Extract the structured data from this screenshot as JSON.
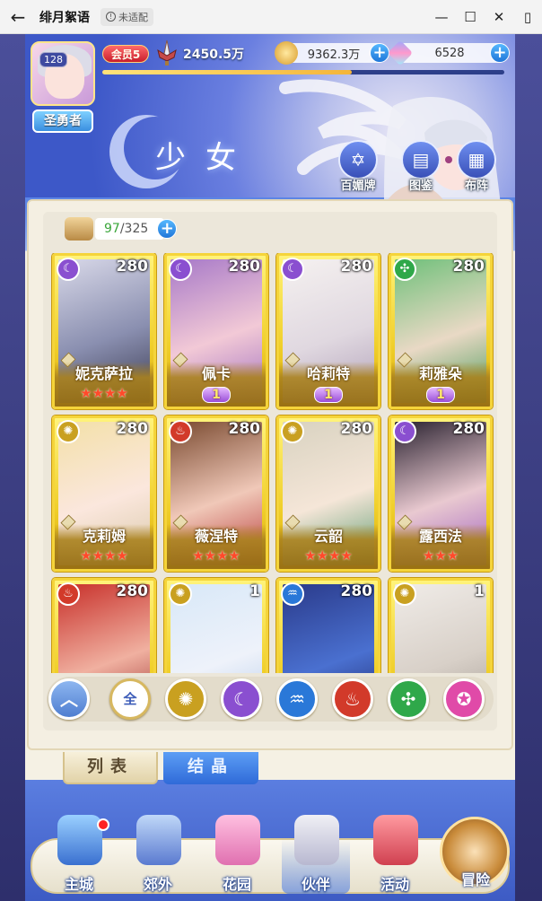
{
  "window": {
    "title": "绯月絮语",
    "badge": "未适配",
    "controls": [
      "—",
      "☐",
      "✕",
      "▯"
    ]
  },
  "header": {
    "level": "128",
    "player_title": "圣勇者",
    "vip": "会员5",
    "power": "2450.5万",
    "exp_fraction": 0.62,
    "gold": "9362.3万",
    "gems": "6528",
    "page_title": "少女",
    "buttons": [
      {
        "label": "百媚牌",
        "icon": "card-deck-icon"
      },
      {
        "label": "图鉴",
        "icon": "book-icon"
      },
      {
        "label": "布阵",
        "icon": "grid-formation-icon"
      }
    ]
  },
  "roster": {
    "count_current": "97",
    "count_total": "/325",
    "cards": [
      {
        "name": "妮克萨拉",
        "level": "280",
        "element": "moon",
        "stars": "★★★★",
        "rank": ""
      },
      {
        "name": "佩卡",
        "level": "280",
        "element": "moon",
        "stars": "",
        "rank": "1"
      },
      {
        "name": "哈莉特",
        "level": "280",
        "element": "moon",
        "stars": "",
        "rank": "1"
      },
      {
        "name": "莉雅朵",
        "level": "280",
        "element": "wind",
        "stars": "",
        "rank": "1"
      },
      {
        "name": "克莉姆",
        "level": "280",
        "element": "sun",
        "stars": "★★★★",
        "rank": ""
      },
      {
        "name": "薇涅特",
        "level": "280",
        "element": "fire",
        "stars": "★★★★",
        "rank": ""
      },
      {
        "name": "云韶",
        "level": "280",
        "element": "sun",
        "stars": "★★★★",
        "rank": ""
      },
      {
        "name": "露西法",
        "level": "280",
        "element": "moon",
        "stars": "★★★",
        "rank": ""
      },
      {
        "name": "",
        "level": "280",
        "element": "fire",
        "stars": "",
        "rank": ""
      },
      {
        "name": "",
        "level": "1",
        "element": "sun",
        "stars": "",
        "rank": ""
      },
      {
        "name": "",
        "level": "280",
        "element": "water",
        "stars": "",
        "rank": ""
      },
      {
        "name": "",
        "level": "1",
        "element": "sun",
        "stars": "",
        "rank": ""
      }
    ]
  },
  "filters": {
    "all_label": "全",
    "items": [
      "sort-icon",
      "all",
      "sun-element-icon",
      "moon-element-icon",
      "water-element-icon",
      "fire-element-icon",
      "wind-element-icon",
      "star-element-icon"
    ]
  },
  "tabs": {
    "list": "列表",
    "crystal": "结晶"
  },
  "nav": {
    "items": [
      "主城",
      "郊外",
      "花园",
      "伙伴",
      "活动"
    ],
    "adventure": "冒险"
  },
  "colors": {
    "moon": "#8a4fd0",
    "sun": "#c9a020",
    "fire": "#d23a2a",
    "water": "#2a78d8",
    "wind": "#2fa84a",
    "star": "#e04aa8"
  }
}
